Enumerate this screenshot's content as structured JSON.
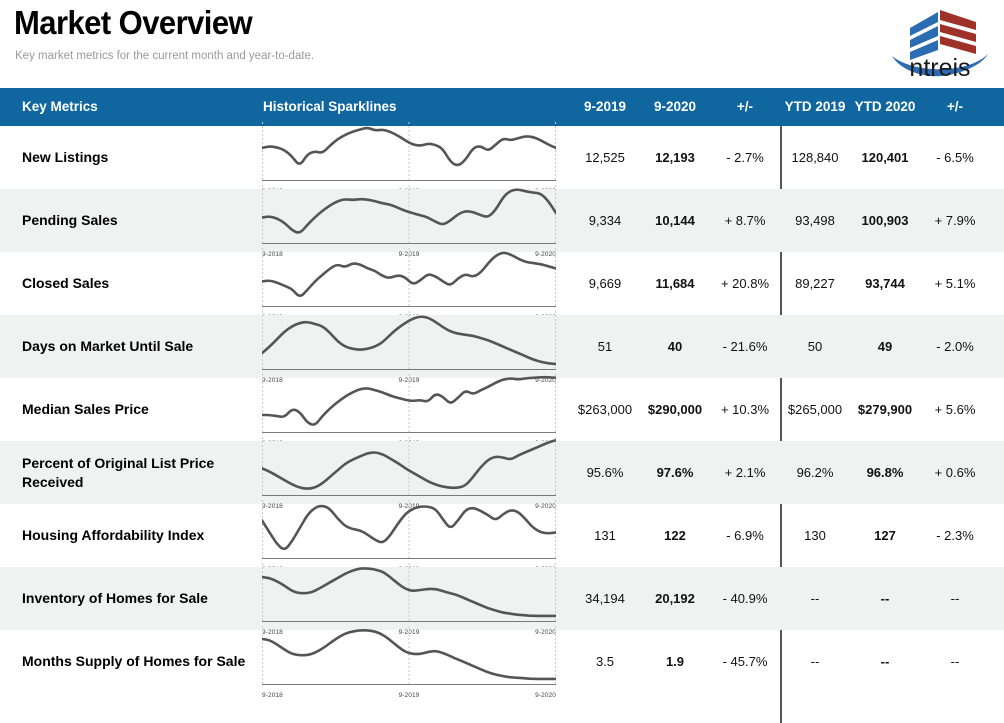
{
  "header": {
    "title": "Market Overview",
    "subtitle": "Key market metrics for the current month and year-to-date.",
    "logo_wordmark": "ntreis",
    "logo_colors": {
      "blue": "#2b6cb3",
      "red": "#9e3229",
      "swoosh": "#2b6cb3"
    }
  },
  "theme": {
    "header_bar": "#10679f",
    "stripe": "#f0f1f1",
    "sparkline": "#555555",
    "divider": "#555555",
    "gridline": "#c9c9c9"
  },
  "table": {
    "columns": [
      {
        "key": "metric",
        "label": "Key Metrics"
      },
      {
        "key": "spark",
        "label": "Historical Sparklines"
      },
      {
        "key": "m_prev",
        "label": "9-2019"
      },
      {
        "key": "m_curr",
        "label": "9-2020"
      },
      {
        "key": "m_chg",
        "label": "+/-"
      },
      {
        "key": "ytd_prev",
        "label": "YTD 2019"
      },
      {
        "key": "ytd_curr",
        "label": "YTD 2020"
      },
      {
        "key": "ytd_chg",
        "label": "+/-"
      }
    ],
    "sparkline_axis": {
      "left": "9-2018",
      "mid": "9-2019",
      "right": "9-2020"
    },
    "rows": [
      {
        "metric": "New Listings",
        "m_prev": "12,525",
        "m_curr": "12,193",
        "m_chg": "- 2.7%",
        "ytd_prev": "128,840",
        "ytd_curr": "120,401",
        "ytd_chg": "- 6.5%",
        "spark": [
          52,
          55,
          53,
          48,
          36,
          18,
          40,
          46,
          42,
          56,
          68,
          76,
          82,
          86,
          90,
          84,
          86,
          82,
          75,
          66,
          58,
          56,
          60,
          58,
          50,
          26,
          18,
          30,
          52,
          56,
          46,
          58,
          70,
          66,
          70,
          74,
          72,
          66,
          58,
          52
        ]
      },
      {
        "metric": "Pending Sales",
        "m_prev": "9,334",
        "m_curr": "10,144",
        "m_chg": "+ 8.7%",
        "ytd_prev": "93,498",
        "ytd_curr": "100,903",
        "ytd_chg": "+ 7.9%",
        "spark": [
          40,
          42,
          38,
          30,
          16,
          10,
          26,
          40,
          52,
          62,
          70,
          74,
          72,
          74,
          73,
          70,
          66,
          64,
          58,
          52,
          48,
          44,
          40,
          32,
          26,
          34,
          46,
          52,
          50,
          44,
          40,
          54,
          78,
          90,
          92,
          88,
          86,
          84,
          70,
          48
        ]
      },
      {
        "metric": "Closed Sales",
        "m_prev": "9,669",
        "m_curr": "11,684",
        "m_chg": "+ 20.8%",
        "ytd_prev": "89,227",
        "ytd_curr": "93,744",
        "ytd_chg": "+ 5.1%",
        "spark": [
          38,
          40,
          36,
          30,
          24,
          8,
          22,
          38,
          50,
          62,
          70,
          64,
          72,
          70,
          62,
          58,
          48,
          44,
          50,
          46,
          32,
          40,
          52,
          48,
          38,
          30,
          44,
          52,
          46,
          54,
          72,
          86,
          92,
          88,
          80,
          74,
          72,
          70,
          66,
          62
        ]
      },
      {
        "metric": "Days on Market Until Sale",
        "m_prev": "51",
        "m_curr": "40",
        "m_chg": "- 21.6%",
        "ytd_prev": "50",
        "ytd_curr": "49",
        "ytd_chg": "- 2.0%",
        "spark": [
          22,
          34,
          48,
          62,
          72,
          78,
          80,
          76,
          72,
          60,
          44,
          34,
          30,
          28,
          30,
          34,
          42,
          56,
          68,
          78,
          86,
          90,
          88,
          80,
          70,
          62,
          58,
          56,
          54,
          50,
          46,
          40,
          34,
          28,
          22,
          16,
          10,
          6,
          3,
          2
        ]
      },
      {
        "metric": "Median Sales Price",
        "m_prev": "$263,000",
        "m_curr": "$290,000",
        "m_chg": "+ 10.3%",
        "ytd_prev": "$265,000",
        "ytd_curr": "$279,900",
        "ytd_chg": "+ 5.6%",
        "spark": [
          24,
          24,
          22,
          20,
          36,
          30,
          10,
          4,
          22,
          36,
          48,
          58,
          66,
          72,
          74,
          70,
          66,
          60,
          56,
          52,
          50,
          52,
          48,
          64,
          58,
          44,
          56,
          70,
          62,
          70,
          76,
          84,
          90,
          92,
          90,
          92,
          93,
          94,
          94,
          93
        ]
      },
      {
        "metric": "Percent of Original List Price Received",
        "m_prev": "95.6%",
        "m_curr": "97.6%",
        "m_chg": "+ 2.1%",
        "ytd_prev": "96.2%",
        "ytd_curr": "96.8%",
        "ytd_chg": "+ 0.6%",
        "spark": [
          42,
          36,
          28,
          20,
          12,
          6,
          4,
          6,
          14,
          26,
          38,
          50,
          58,
          64,
          70,
          72,
          68,
          60,
          52,
          42,
          34,
          26,
          18,
          12,
          8,
          6,
          6,
          10,
          26,
          44,
          58,
          64,
          62,
          58,
          66,
          72,
          78,
          84,
          90,
          94
        ]
      },
      {
        "metric": "Housing Affordability Index",
        "m_prev": "131",
        "m_curr": "122",
        "m_chg": "- 6.9%",
        "ytd_prev": "130",
        "ytd_curr": "127",
        "ytd_chg": "- 2.3%",
        "spark": [
          62,
          40,
          18,
          6,
          24,
          48,
          72,
          86,
          90,
          84,
          66,
          52,
          46,
          44,
          36,
          26,
          20,
          34,
          56,
          74,
          84,
          88,
          88,
          84,
          64,
          46,
          62,
          82,
          86,
          80,
          72,
          62,
          74,
          82,
          78,
          64,
          48,
          40,
          38,
          40
        ]
      },
      {
        "metric": "Inventory of Homes for Sale",
        "m_prev": "34,194",
        "m_curr": "20,192",
        "m_chg": "- 40.9%",
        "ytd_prev": "--",
        "ytd_curr": "--",
        "ytd_chg": "--",
        "spark": [
          74,
          72,
          66,
          58,
          48,
          44,
          44,
          48,
          56,
          64,
          72,
          80,
          86,
          90,
          90,
          88,
          84,
          74,
          62,
          52,
          48,
          50,
          52,
          52,
          48,
          44,
          40,
          34,
          28,
          22,
          16,
          12,
          8,
          6,
          4,
          3,
          2,
          2,
          2,
          2
        ]
      },
      {
        "metric": "Months Supply of Homes for Sale",
        "m_prev": "3.5",
        "m_curr": "1.9",
        "m_chg": "- 45.7%",
        "ytd_prev": "--",
        "ytd_curr": "--",
        "ytd_chg": "--",
        "spark": [
          76,
          74,
          66,
          56,
          48,
          46,
          46,
          50,
          58,
          68,
          78,
          86,
          90,
          92,
          92,
          90,
          84,
          74,
          62,
          52,
          48,
          48,
          52,
          54,
          50,
          44,
          38,
          32,
          26,
          20,
          14,
          10,
          7,
          5,
          4,
          3,
          2,
          2,
          2,
          2
        ]
      }
    ]
  }
}
